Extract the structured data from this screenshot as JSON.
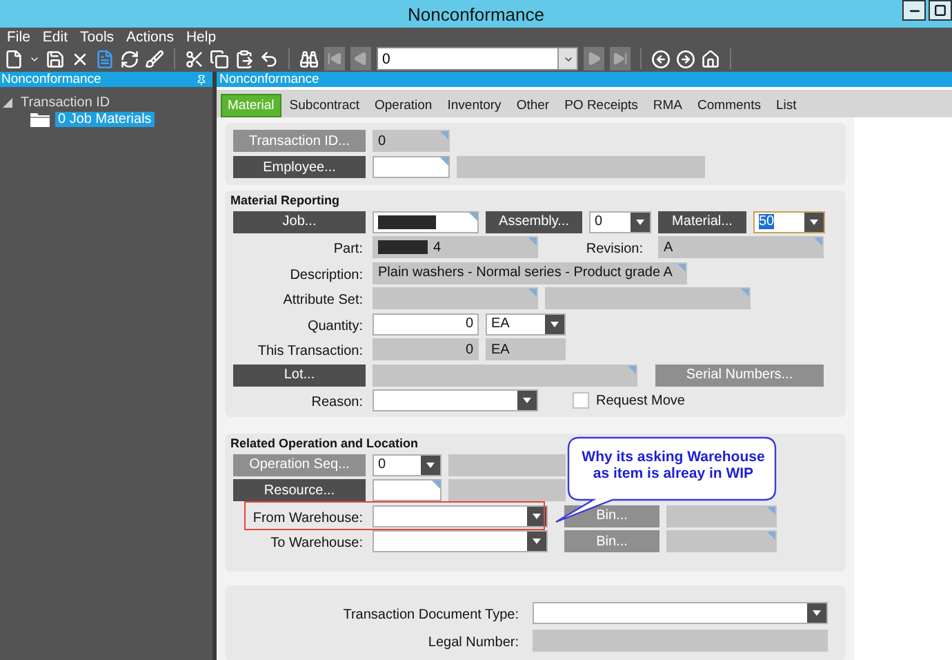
{
  "window": {
    "title": "Nonconformance"
  },
  "menu": [
    {
      "label": "File"
    },
    {
      "label": "Edit"
    },
    {
      "label": "Tools"
    },
    {
      "label": "Actions"
    },
    {
      "label": "Help"
    }
  ],
  "toolbar": {
    "record_field": {
      "value": "0"
    }
  },
  "tree": {
    "header": "Nonconformance",
    "items": [
      {
        "label": "Transaction ID",
        "expanded": true,
        "children": [
          {
            "label": "0 Job Materials",
            "selected": true
          }
        ]
      }
    ]
  },
  "panel_header": "Nonconformance",
  "tabs": [
    {
      "label": "Material",
      "selected": true
    },
    {
      "label": "Subcontract",
      "selected": false
    },
    {
      "label": "Operation",
      "selected": false
    },
    {
      "label": "Inventory",
      "selected": false
    },
    {
      "label": "Other",
      "selected": false
    },
    {
      "label": "PO Receipts",
      "selected": false
    },
    {
      "label": "RMA",
      "selected": false
    },
    {
      "label": "Comments",
      "selected": false
    },
    {
      "label": "List",
      "selected": false
    }
  ],
  "header_section": {
    "transaction_id": {
      "button": {
        "label": "Transaction ID...",
        "disabled": true
      },
      "value": "0"
    },
    "employee": {
      "button": {
        "label": "Employee...",
        "disabled": false
      }
    }
  },
  "material_reporting": {
    "title": "Material Reporting",
    "job": {
      "button": {
        "label": "Job...",
        "disabled": false
      },
      "redacted": true
    },
    "assembly": {
      "button": {
        "label": "Assembly...",
        "disabled": false
      },
      "value": "0"
    },
    "material": {
      "button": {
        "label": "Material...",
        "disabled": false
      },
      "value": "50",
      "highlighted": true
    },
    "part": {
      "label": "Part:",
      "value": "4",
      "redacted": true
    },
    "revision": {
      "label": "Revision:",
      "value": "A"
    },
    "description": {
      "label": "Description:",
      "value": "Plain washers - Normal series - Product grade A"
    },
    "attribute_set": {
      "label": "Attribute Set:"
    },
    "quantity": {
      "label": "Quantity:",
      "value": "0",
      "uom": "EA"
    },
    "this_transaction": {
      "label": "This Transaction:",
      "value": "0",
      "uom": "EA"
    },
    "lot": {
      "button": {
        "label": "Lot...",
        "disabled": false
      }
    },
    "serial_numbers": {
      "label": "Serial Numbers...",
      "disabled": true
    },
    "reason": {
      "label": "Reason:"
    },
    "request_move": {
      "label": "Request Move",
      "checked": false
    }
  },
  "related_operation": {
    "title": "Related Operation and Location",
    "operation_seq": {
      "button": {
        "label": "Operation Seq...",
        "disabled": true
      },
      "value": "0"
    },
    "resource": {
      "button": {
        "label": "Resource...",
        "disabled": false
      }
    },
    "warehouses": [
      {
        "label": "From Warehouse:",
        "bin": {
          "label": "Bin...",
          "disabled": true
        },
        "highlighted": true
      },
      {
        "label": "To Warehouse:",
        "bin": {
          "label": "Bin...",
          "disabled": true
        },
        "highlighted": false
      }
    ]
  },
  "document": {
    "transaction_document_type": {
      "label": "Transaction Document Type:"
    },
    "legal_number": {
      "label": "Legal Number:"
    }
  },
  "annotation": {
    "text": "Why its asking Warehouse as item is alreay in WIP"
  }
}
